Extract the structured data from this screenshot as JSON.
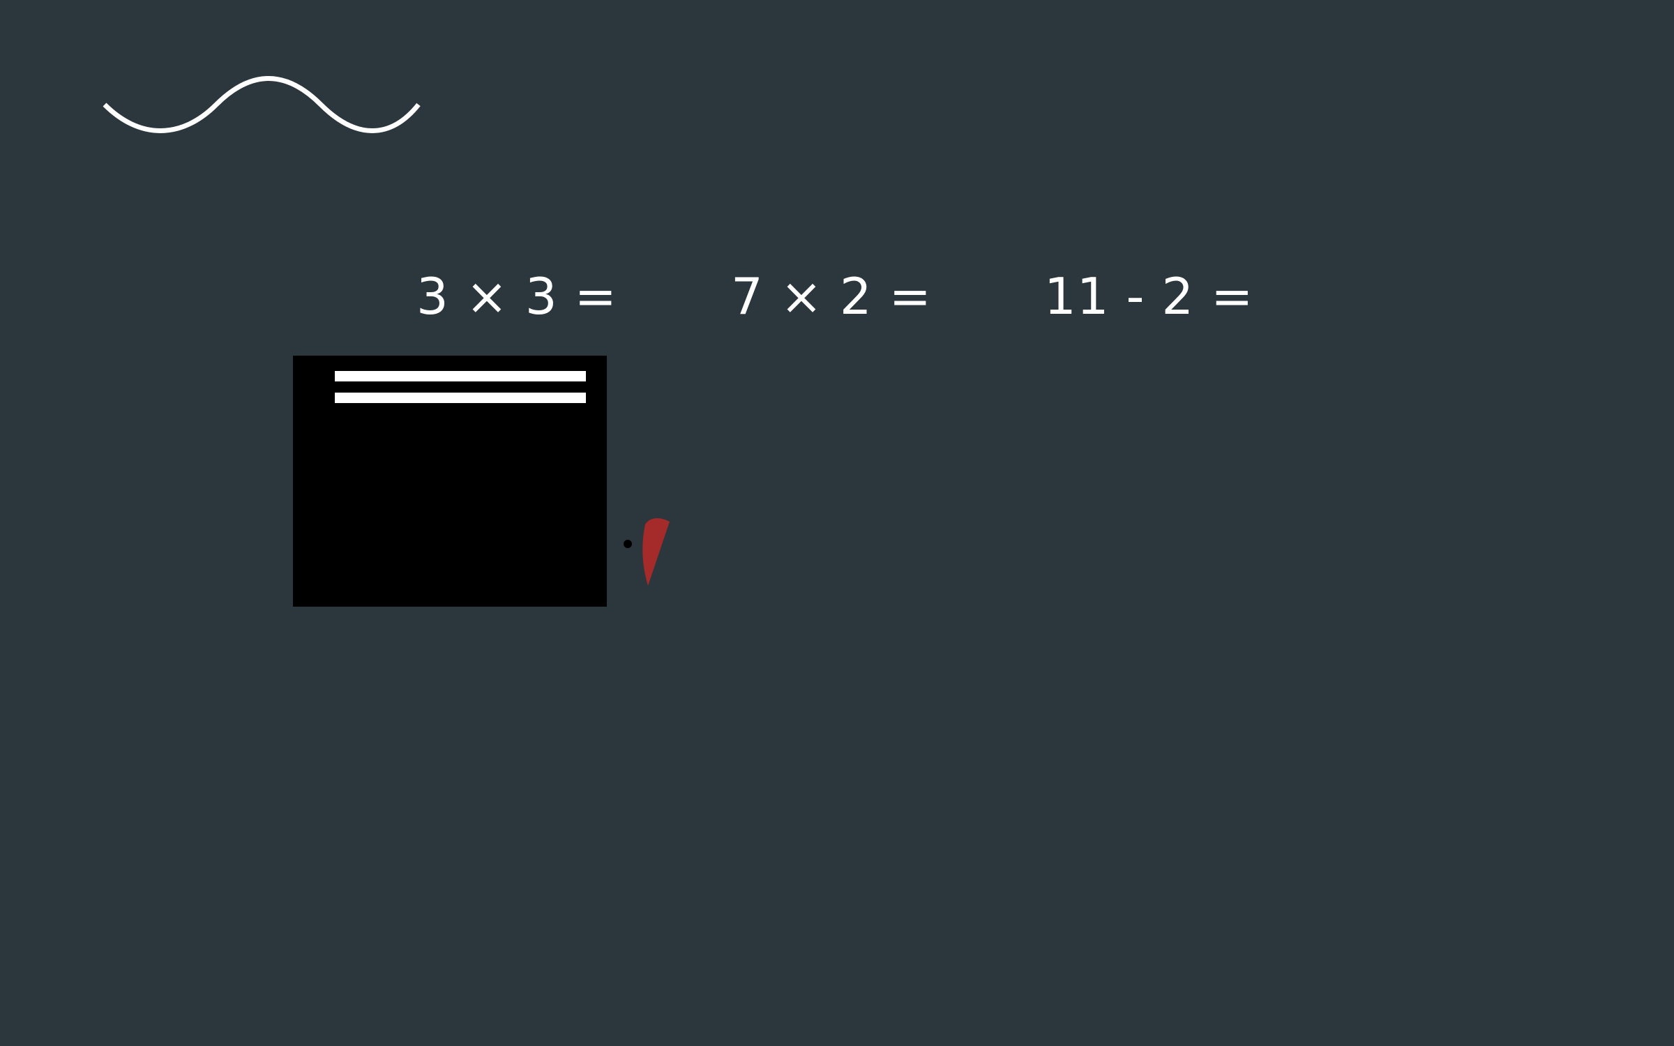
{
  "equations": [
    {
      "text": "3 × 3 ="
    },
    {
      "text": "7 × 2 ="
    },
    {
      "text": "11 - 2 ="
    }
  ],
  "colors": {
    "background": "#2b373d",
    "text": "#ffffff",
    "card": "#000000",
    "pen_tip": "#a52a2a"
  },
  "icons": {
    "wave": "wave-squiggle-icon",
    "pen": "red-marker-tip-icon"
  }
}
